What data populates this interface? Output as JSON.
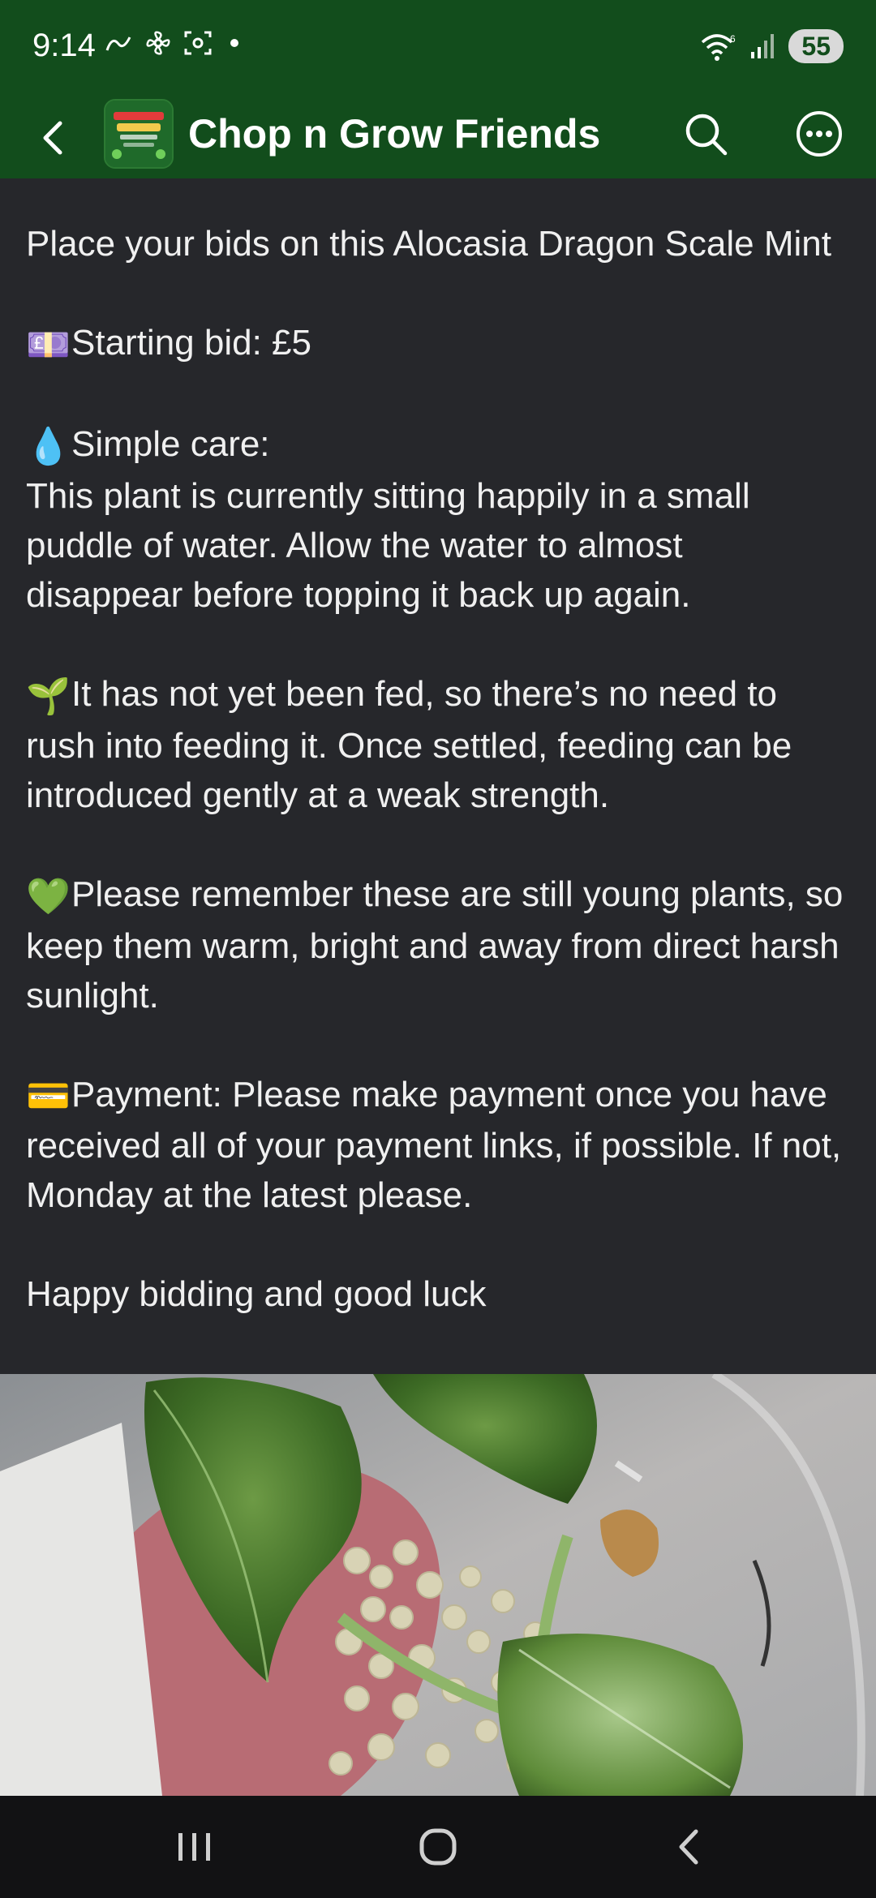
{
  "status_bar": {
    "time": "9:14",
    "battery": "55",
    "left_icons": [
      "signal-a-icon",
      "fan-icon",
      "screenshot-icon"
    ],
    "right_icons": [
      "wifi-6-icon",
      "cellular-signal-icon"
    ]
  },
  "app_bar": {
    "title": "Chop n Grow Friends",
    "avatar_icon": "group-logo-icon",
    "back_icon": "back-chevron-icon",
    "search_icon": "search-icon",
    "more_icon": "more-options-icon"
  },
  "post": {
    "paragraphs": [
      {
        "emoji": "",
        "text": "Place your bids on this Alocasia Dragon Scale Mint"
      },
      {
        "emoji": "💷",
        "text": "Starting bid: £5"
      },
      {
        "emoji": "💧",
        "text": "Simple care:\nThis plant is currently sitting happily in a small puddle of water. Allow the water to almost disappear before topping it back up again."
      },
      {
        "emoji": "🌱",
        "text": "It has not yet been fed, so there’s no need to rush into feeding it. Once settled, feeding can be introduced gently at a weak strength."
      },
      {
        "emoji": "💚",
        "text": "Please remember these are still young plants, so keep them warm, bright and away from direct harsh sunlight."
      },
      {
        "emoji": "💳",
        "text": "Payment: Please make payment once you have received all of your payment links, if possible. If not, Monday at the latest please."
      },
      {
        "emoji": "",
        "text": "Happy bidding and good luck"
      }
    ]
  },
  "colors": {
    "header_green": "#124d1c",
    "background": "#26272b",
    "text": "#f0f0f0"
  },
  "nav_bar": {
    "recents_icon": "recent-apps-icon",
    "home_icon": "home-icon",
    "back_icon": "back-icon"
  }
}
